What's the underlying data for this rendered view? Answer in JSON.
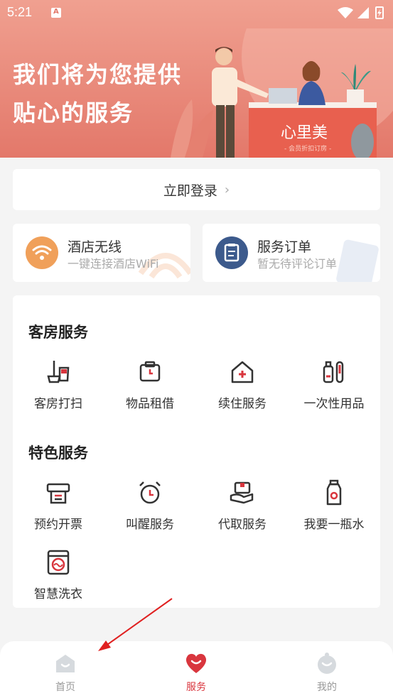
{
  "status_bar": {
    "time": "5:21"
  },
  "hero": {
    "line1": "我们将为您提供",
    "line2": "贴心的服务",
    "sign_text": "心里美",
    "sign_sub": "- 会员折扣订房 -"
  },
  "login": {
    "label": "立即登录",
    "chevron": "›"
  },
  "wifi_card": {
    "title": "酒店无线",
    "subtitle": "一键连接酒店WiFi"
  },
  "order_card": {
    "title": "服务订单",
    "subtitle": "暂无待评论订单"
  },
  "room_service": {
    "title": "客房服务",
    "items": [
      {
        "label": "客房打扫",
        "icon": "cleaning-icon"
      },
      {
        "label": "物品租借",
        "icon": "rental-icon"
      },
      {
        "label": "续住服务",
        "icon": "extend-stay-icon"
      },
      {
        "label": "一次性用品",
        "icon": "toiletries-icon"
      }
    ]
  },
  "special_service": {
    "title": "特色服务",
    "items": [
      {
        "label": "预约开票",
        "icon": "invoice-icon"
      },
      {
        "label": "叫醒服务",
        "icon": "alarm-clock-icon"
      },
      {
        "label": "代取服务",
        "icon": "pickup-icon"
      },
      {
        "label": "我要一瓶水",
        "icon": "water-bottle-icon"
      },
      {
        "label": "智慧洗衣",
        "icon": "washing-machine-icon"
      }
    ]
  },
  "tabbar": {
    "tabs": [
      {
        "label": "首页",
        "icon": "home-icon",
        "active": false
      },
      {
        "label": "服务",
        "icon": "service-heart-icon",
        "active": true
      },
      {
        "label": "我的",
        "icon": "profile-icon",
        "active": false
      }
    ]
  },
  "colors": {
    "accent": "#d9363e",
    "hero": "#e3786a",
    "wifi": "#f0a05a",
    "order": "#3c5a8c",
    "icon_red": "#d9363e",
    "icon_dark": "#333333"
  }
}
